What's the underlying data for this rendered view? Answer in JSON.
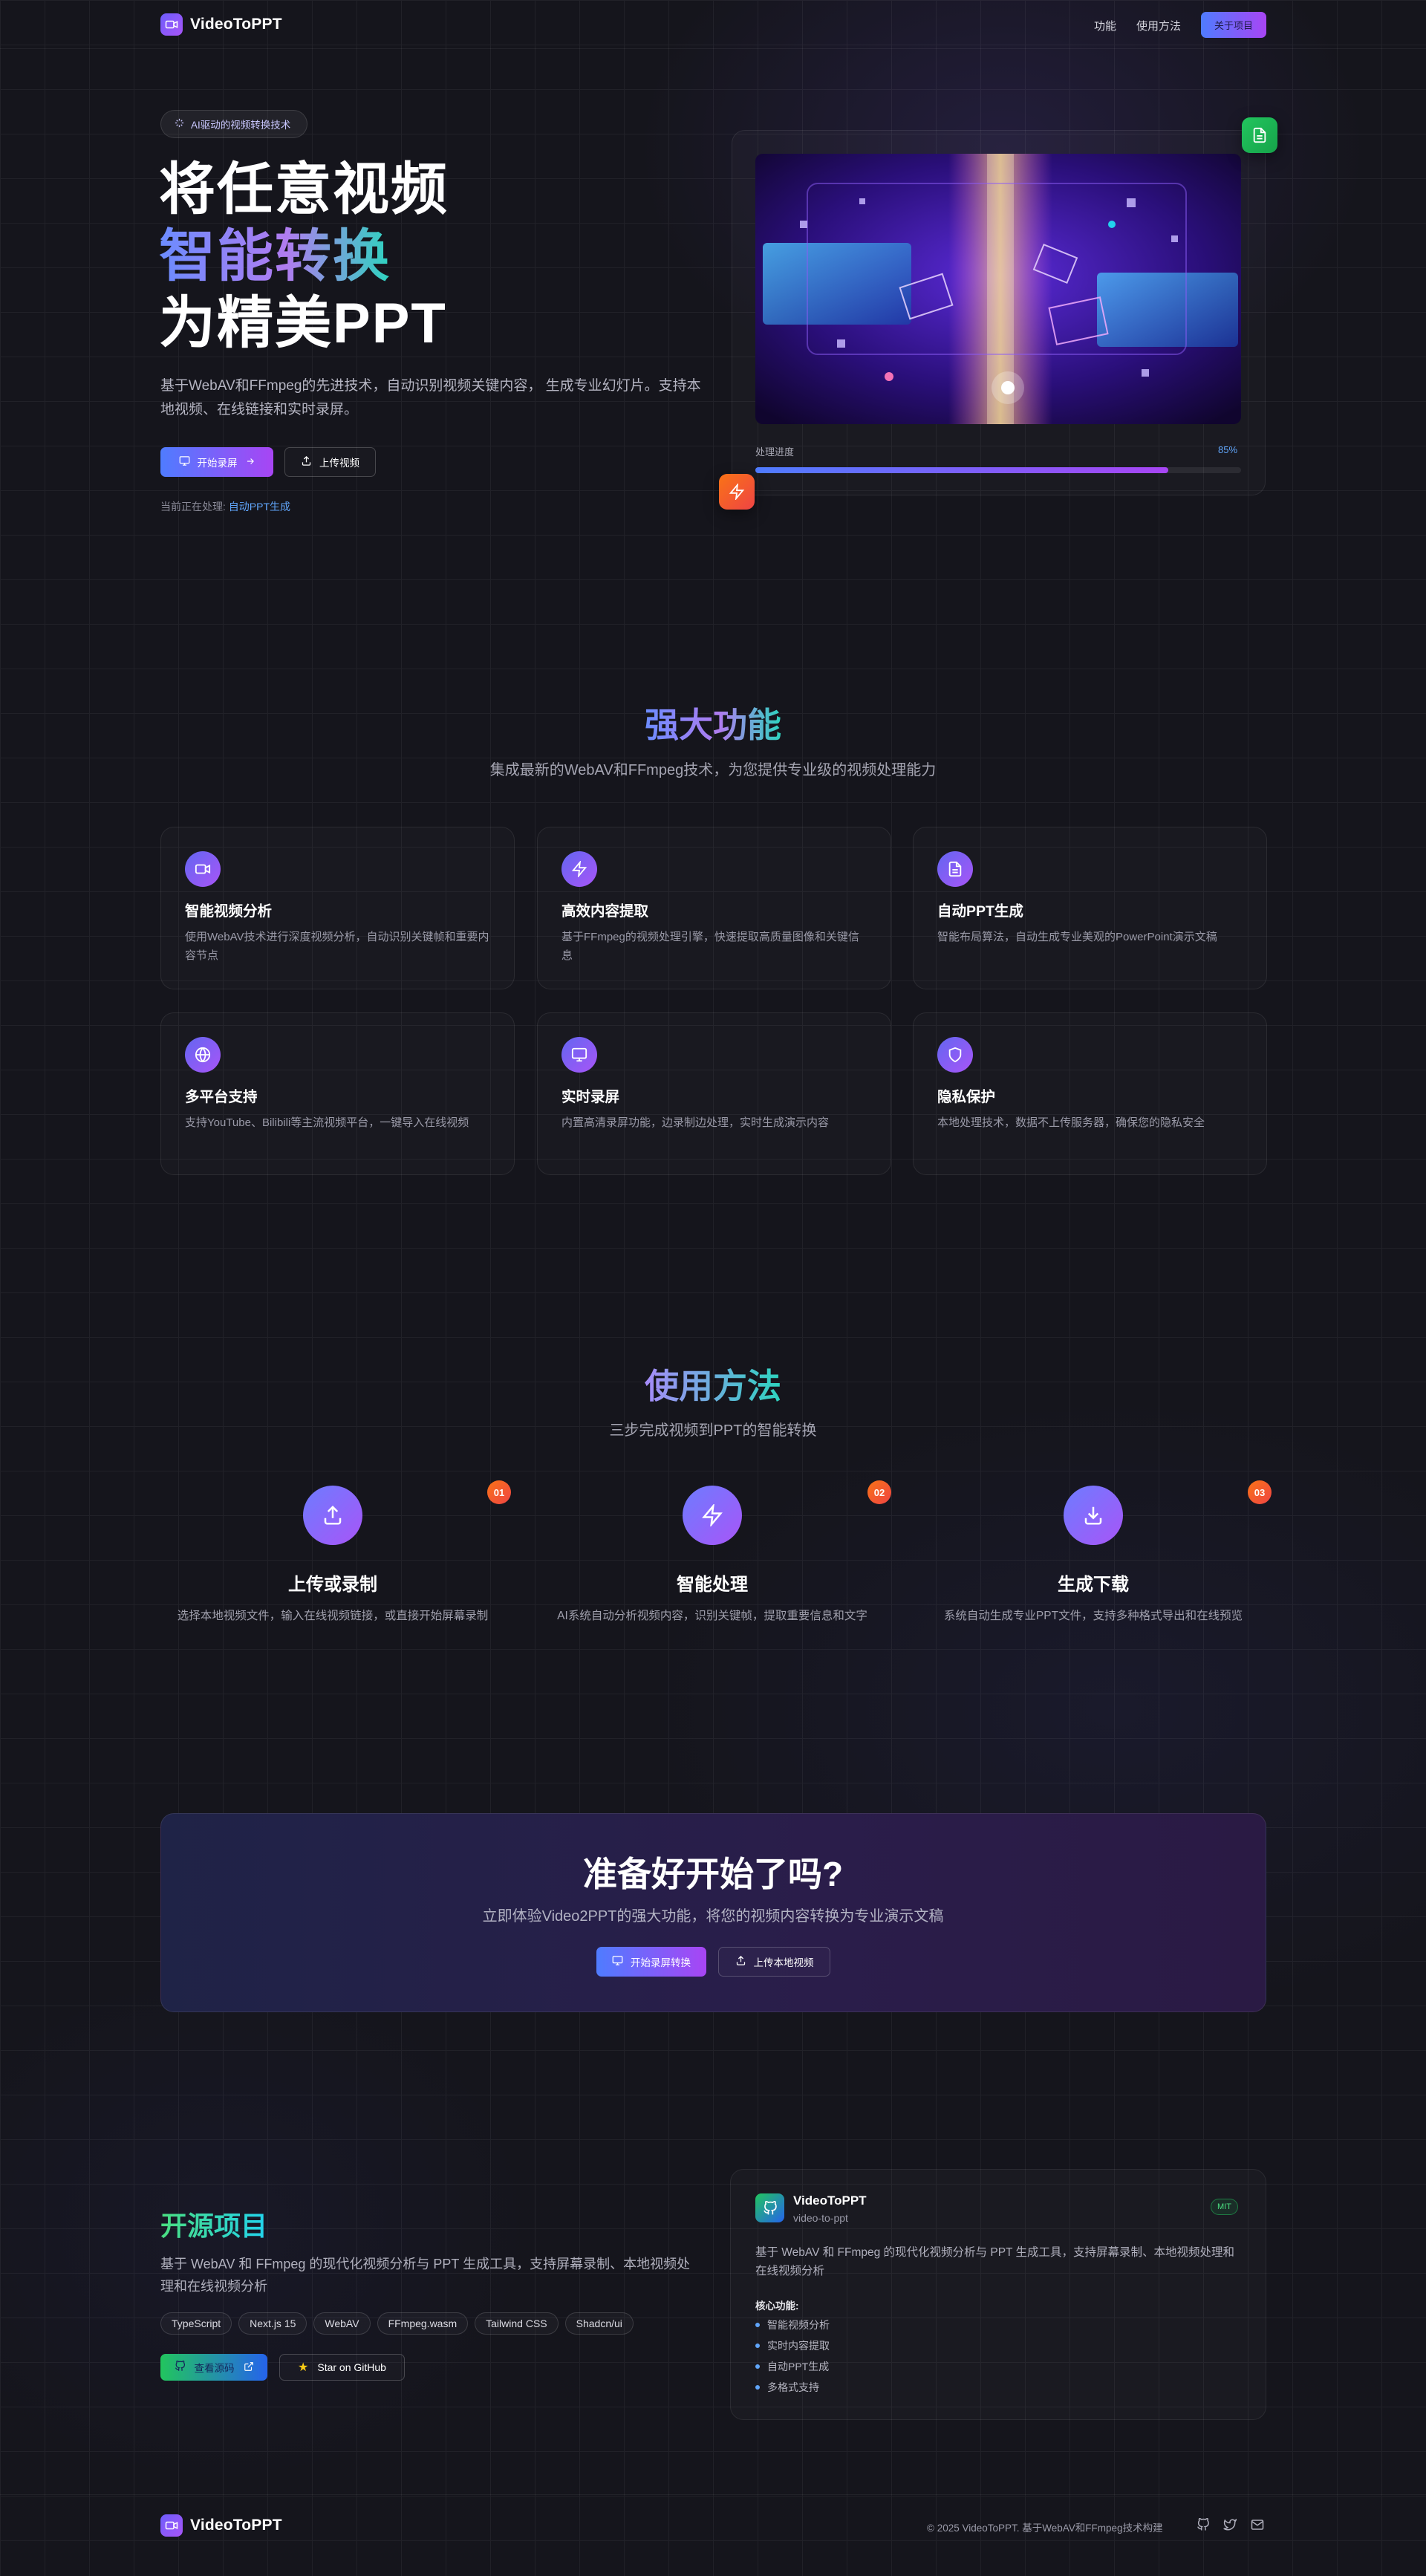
{
  "nav": {
    "brand": "VideoToPPT",
    "links": [
      "功能",
      "使用方法"
    ],
    "about_label": "关于项目"
  },
  "hero": {
    "badge": "AI驱动的视频转换技术",
    "title_line1": "将任意视频",
    "title_line2": "智能转换",
    "title_line3": "为精美PPT",
    "description": "基于WebAV和FFmpeg的先进技术，自动识别视频关键内容， 生成专业幻灯片。支持本地视频、在线链接和实时录屏。",
    "primary_label": "开始录屏",
    "secondary_label": "上传视频",
    "processing_label": "当前正在处理:",
    "processing_value": "自动PPT生成",
    "progress_label": "处理进度",
    "progress_value": "85%",
    "progress_fraction": 0.85
  },
  "features": {
    "title": "强大功能",
    "subtitle": "集成最新的WebAV和FFmpeg技术，为您提供专业级的视频处理能力",
    "items": [
      {
        "icon": "video-icon",
        "title": "智能视频分析",
        "desc": "使用WebAV技术进行深度视频分析，自动识别关键帧和重要内容节点"
      },
      {
        "icon": "zap-icon",
        "title": "高效内容提取",
        "desc": "基于FFmpeg的视频处理引擎，快速提取高质量图像和关键信息"
      },
      {
        "icon": "file-icon",
        "title": "自动PPT生成",
        "desc": "智能布局算法，自动生成专业美观的PowerPoint演示文稿"
      },
      {
        "icon": "globe-icon",
        "title": "多平台支持",
        "desc": "支持YouTube、Bilibili等主流视频平台，一键导入在线视频"
      },
      {
        "icon": "monitor-icon",
        "title": "实时录屏",
        "desc": "内置高清录屏功能，边录制边处理，实时生成演示内容"
      },
      {
        "icon": "shield-icon",
        "title": "隐私保护",
        "desc": "本地处理技术，数据不上传服务器，确保您的隐私安全"
      }
    ]
  },
  "howto": {
    "title": "使用方法",
    "subtitle": "三步完成视频到PPT的智能转换",
    "steps": [
      {
        "num": "01",
        "icon": "upload-icon",
        "title": "上传或录制",
        "desc": "选择本地视频文件，输入在线视频链接，或直接开始屏幕录制"
      },
      {
        "num": "02",
        "icon": "zap-icon",
        "title": "智能处理",
        "desc": "AI系统自动分析视频内容，识别关键帧，提取重要信息和文字"
      },
      {
        "num": "03",
        "icon": "download-icon",
        "title": "生成下载",
        "desc": "系统自动生成专业PPT文件，支持多种格式导出和在线预览"
      }
    ]
  },
  "cta": {
    "title": "准备好开始了吗?",
    "subtitle": "立即体验Video2PPT的强大功能，将您的视频内容转换为专业演示文稿",
    "primary_label": "开始录屏转换",
    "secondary_label": "上传本地视频"
  },
  "opensource": {
    "title": "开源项目",
    "description": "基于 WebAV 和 FFmpeg 的现代化视频分析与 PPT 生成工具，支持屏幕录制、本地视频处理和在线视频分析",
    "tags": [
      "TypeScript",
      "Next.js 15",
      "WebAV",
      "FFmpeg.wasm",
      "Tailwind CSS",
      "Shadcn/ui"
    ],
    "source_label": "查看源码",
    "star_label": "Star on GitHub",
    "repo": {
      "name": "VideoToPPT",
      "slug": "video-to-ppt",
      "license": "MIT",
      "description": "基于 WebAV 和 FFmpeg 的现代化视频分析与 PPT 生成工具，支持屏幕录制、本地视频处理和在线视频分析",
      "features_title": "核心功能:",
      "features": [
        "智能视频分析",
        "实时内容提取",
        "自动PPT生成",
        "多格式支持"
      ]
    }
  },
  "footer": {
    "brand": "VideoToPPT",
    "copyright": "© 2025 VideoToPPT. 基于WebAV和FFmpeg技术构建"
  },
  "colors": {
    "accent_start": "#4f7cff",
    "accent_end": "#a845f4",
    "teal": "#2dd4bf",
    "badge_orange": "#f97316",
    "success_green": "#16a34a",
    "background": "#15151c"
  }
}
